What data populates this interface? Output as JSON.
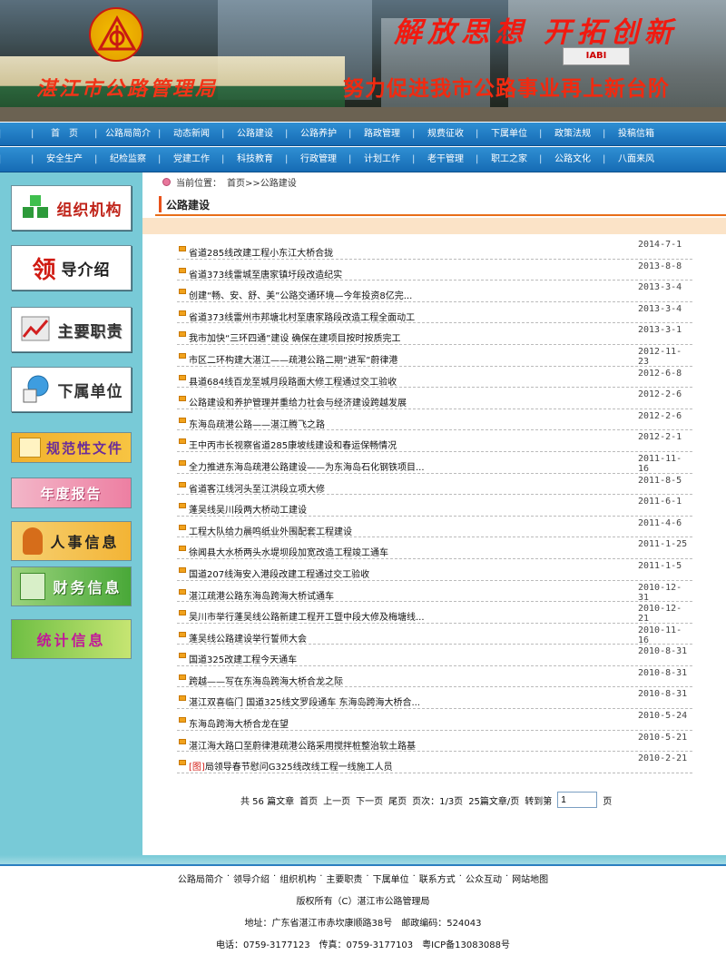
{
  "banner": {
    "org_name": "湛江市公路管理局",
    "slogan_top": "解放思想  开拓创新",
    "slogan_bottom": "努力促进我市公路事业再上新台阶",
    "sign_text": "IABI"
  },
  "nav_row1": [
    "首　页",
    "公路局简介",
    "动态新闻",
    "公路建设",
    "公路养护",
    "路政管理",
    "规费征收",
    "下属单位",
    "政策法规",
    "投稿信箱"
  ],
  "nav_row2": [
    "安全生产",
    "纪检监察",
    "党建工作",
    "科技教育",
    "行政管理",
    "计划工作",
    "老干管理",
    "职工之家",
    "公路文化",
    "八面来风"
  ],
  "sidebar": {
    "org": "组织机构",
    "leader_big": "领",
    "leader_rest": "导介绍",
    "duties": "主要职责",
    "units": "下属单位",
    "docs": "规范性文件",
    "annual": "年度报告",
    "hr": "人事信息",
    "finance": "财务信息",
    "stats": "统计信息"
  },
  "breadcrumb": {
    "label": "当前位置：",
    "path": "首页>>公路建设"
  },
  "section_title": "公路建设",
  "news": [
    {
      "title": "省道285线改建工程小东江大桥合拢",
      "date": "2014-7-1"
    },
    {
      "title": "省道373线雷城至唐家镇圩段改造纪实",
      "date": "2013-8-8"
    },
    {
      "title": "创建“畅、安、舒、美”公路交通环境—今年投资8亿完...",
      "date": "2013-3-4"
    },
    {
      "title": "省道373线雷州市邦塘北村至唐家路段改造工程全面动工",
      "date": "2013-3-4"
    },
    {
      "title": "我市加快“三环四通”建设 确保在建项目按时按质完工",
      "date": "2013-3-1"
    },
    {
      "title": "市区二环构建大湛江——疏港公路二期“进军”蔚律港",
      "date": "2012-11-23"
    },
    {
      "title": "县道684线百龙至城月段路面大修工程通过交工验收",
      "date": "2012-6-8"
    },
    {
      "title": "公路建设和养护管理并重给力社会与经济建设跨越发展",
      "date": "2012-2-6"
    },
    {
      "title": "东海岛疏港公路——湛江腾飞之路",
      "date": "2012-2-6"
    },
    {
      "title": "王中丙市长视察省道285康坡线建设和春运保畅情况",
      "date": "2012-2-1"
    },
    {
      "title": "全力推进东海岛疏港公路建设——为东海岛石化钢铁项目...",
      "date": "2011-11-16"
    },
    {
      "title": "省道客江线河头至江洪段立项大修",
      "date": "2011-8-5"
    },
    {
      "title": "蓬吴线吴川段两大桥动工建设",
      "date": "2011-6-1"
    },
    {
      "title": "工程大队给力晨鸣纸业外围配套工程建设",
      "date": "2011-4-6"
    },
    {
      "title": "徐闻县大水桥两头水堤坝段加宽改造工程竣工通车",
      "date": "2011-1-25"
    },
    {
      "title": "国道207线海安入港段改建工程通过交工验收",
      "date": "2011-1-5"
    },
    {
      "title": "湛江疏港公路东海岛跨海大桥试通车",
      "date": "2010-12-31"
    },
    {
      "title": "吴川市举行蓬吴线公路新建工程开工暨中段大修及梅塘线...",
      "date": "2010-12-21"
    },
    {
      "title": "蓬吴线公路建设举行誓师大会",
      "date": "2010-11-16"
    },
    {
      "title": "国道325改建工程今天通车",
      "date": "2010-8-31"
    },
    {
      "title": "跨越——写在东海岛跨海大桥合龙之际",
      "date": "2010-8-31"
    },
    {
      "title": "湛江双喜临门 国道325线文罗段通车 东海岛跨海大桥合...",
      "date": "2010-8-31"
    },
    {
      "title": "东海岛跨海大桥合龙在望",
      "date": "2010-5-24"
    },
    {
      "title": "湛江海大路口至蔚律港疏港公路采用搅拌桩整治软土路基",
      "date": "2010-5-21"
    },
    {
      "tag": "[图]",
      "title": "局领导春节慰问G325线改线工程一线施工人员",
      "date": "2010-2-21"
    }
  ],
  "pager": {
    "total": "共 56 篇文章",
    "first": "首页",
    "prev": "上一页",
    "next": "下一页",
    "last": "尾页",
    "page_info": "页次：1/3页",
    "per_page": "25篇文章/页",
    "goto_label": "转到第",
    "goto_value": "1",
    "goto_suffix": "页"
  },
  "footer": {
    "links": [
      "公路局简介",
      "领导介绍",
      "组织机构",
      "主要职责",
      "下属单位",
      "联系方式",
      "公众互动",
      "网站地图"
    ],
    "copyright": "版权所有（C）湛江市公路管理局",
    "address": "地址：广东省湛江市赤坎康顺路38号　邮政编码：524043",
    "contact": "电话：0759-3177123　传真：0759-3177103　粤ICP备13083088号"
  }
}
